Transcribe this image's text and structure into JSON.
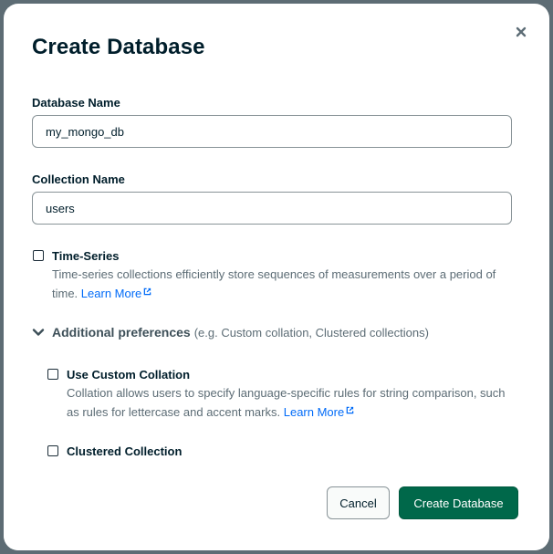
{
  "dialog": {
    "title": "Create Database",
    "close_icon": "close-icon"
  },
  "database_name": {
    "label": "Database Name",
    "value": "my_mongo_db"
  },
  "collection_name": {
    "label": "Collection Name",
    "value": "users"
  },
  "time_series": {
    "label": "Time-Series",
    "checked": false,
    "description": "Time-series collections efficiently store sequences of measurements over a period of time.",
    "link": "Learn More",
    "link_icon": "external-link-icon"
  },
  "additional_preferences": {
    "icon": "chevron-down-icon",
    "title": "Additional preferences",
    "hint": "(e.g. Custom collation, Clustered collections)",
    "expanded": true
  },
  "custom_collation": {
    "label": "Use Custom Collation",
    "checked": false,
    "description": "Collation allows users to specify language-specific rules for string comparison, such as rules for lettercase and accent marks.",
    "link": "Learn More",
    "link_icon": "external-link-icon"
  },
  "clustered_collection": {
    "label": "Clustered Collection",
    "checked": false
  },
  "footer": {
    "cancel_label": "Cancel",
    "create_label": "Create Database"
  },
  "colors": {
    "primary_button": "#00684a",
    "link": "#016bf8",
    "backdrop": "#5d6c74"
  }
}
